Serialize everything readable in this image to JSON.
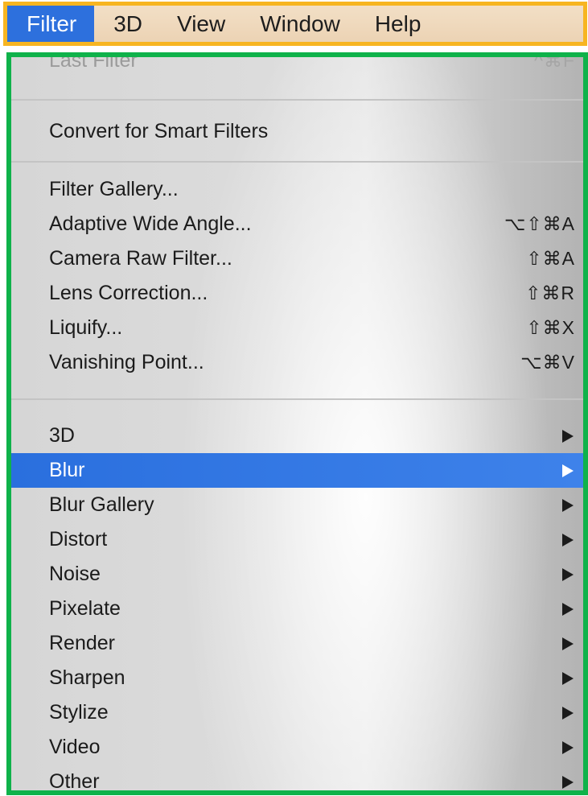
{
  "menubar": {
    "items": [
      {
        "label": "Filter"
      },
      {
        "label": "3D"
      },
      {
        "label": "View"
      },
      {
        "label": "Window"
      },
      {
        "label": "Help"
      }
    ]
  },
  "menu": {
    "last_filter": {
      "label": "Last Filter",
      "shortcut": "^⌘F"
    },
    "convert_smart": {
      "label": "Convert for Smart Filters"
    },
    "group_filters": [
      {
        "label": "Filter Gallery...",
        "shortcut": ""
      },
      {
        "label": "Adaptive Wide Angle...",
        "shortcut": "⌥⇧⌘A"
      },
      {
        "label": "Camera Raw Filter...",
        "shortcut": "⇧⌘A"
      },
      {
        "label": "Lens Correction...",
        "shortcut": "⇧⌘R"
      },
      {
        "label": "Liquify...",
        "shortcut": "⇧⌘X"
      },
      {
        "label": "Vanishing Point...",
        "shortcut": "⌥⌘V"
      }
    ],
    "submenus": [
      {
        "label": "3D"
      },
      {
        "label": "Blur"
      },
      {
        "label": "Blur Gallery"
      },
      {
        "label": "Distort"
      },
      {
        "label": "Noise"
      },
      {
        "label": "Pixelate"
      },
      {
        "label": "Render"
      },
      {
        "label": "Sharpen"
      },
      {
        "label": "Stylize"
      },
      {
        "label": "Video"
      },
      {
        "label": "Other"
      }
    ],
    "selected_submenu": "Blur"
  },
  "colors": {
    "menubar_border": "#f7b521",
    "menu_border": "#0fb24a",
    "selection": "#2d70dd"
  }
}
